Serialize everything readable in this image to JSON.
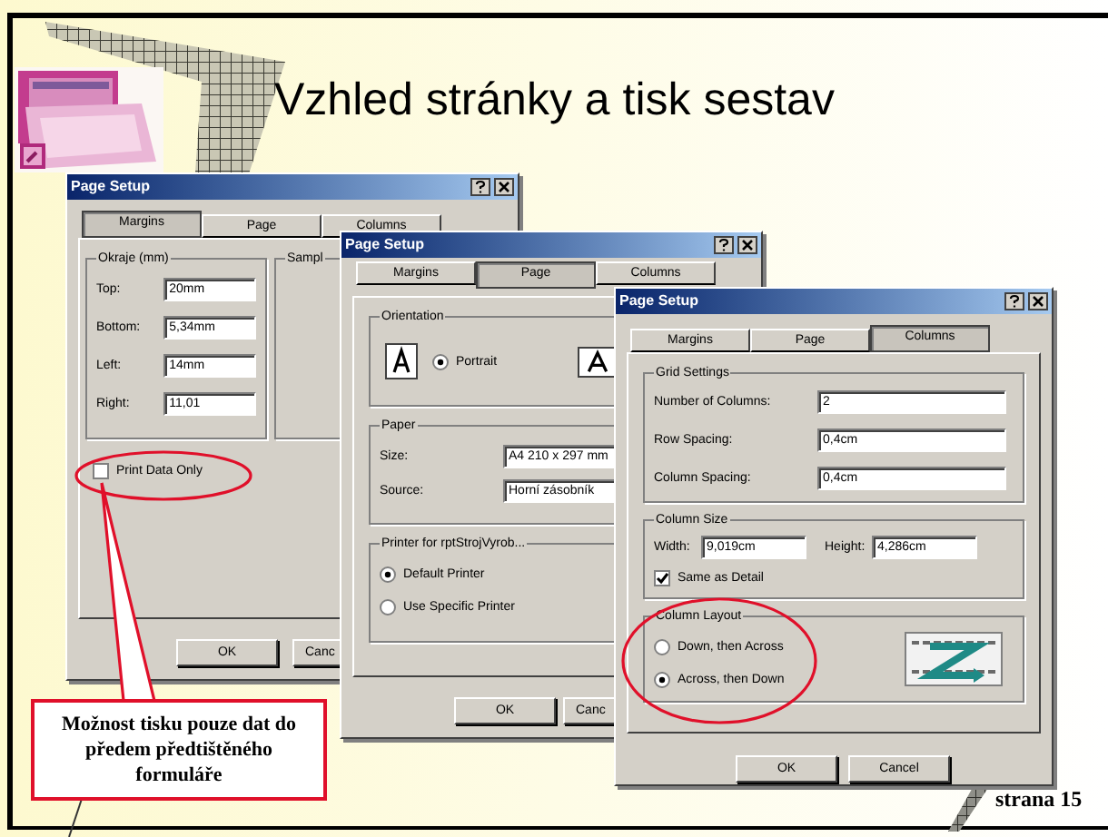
{
  "slide": {
    "title": "Vzhled stránky a tisk sestav",
    "callout": "Možnost tisku pouze dat do předem předtištěného formuláře",
    "page_number": "strana 15"
  },
  "dialogs": [
    {
      "kind": "margins",
      "title": "Page Setup",
      "tabs": [
        {
          "label": "Margins",
          "selected": true
        },
        {
          "label": "Page",
          "selected": false
        },
        {
          "label": "Columns",
          "selected": false
        }
      ],
      "margins_group": {
        "label": "Okraje (mm)",
        "fields": [
          {
            "label": "Top:",
            "value": "20mm"
          },
          {
            "label": "Bottom:",
            "value": "5,34mm"
          },
          {
            "label": "Left:",
            "value": "14mm"
          },
          {
            "label": "Right:",
            "value": "11,01"
          }
        ]
      },
      "sample_group": {
        "label": "Sampl"
      },
      "print_data_only": {
        "label": "Print Data Only",
        "checked": false
      },
      "buttons": [
        "OK",
        "Canc"
      ]
    },
    {
      "kind": "page",
      "title": "Page Setup",
      "tabs": [
        {
          "label": "Margins",
          "selected": false
        },
        {
          "label": "Page",
          "selected": true
        },
        {
          "label": "Columns",
          "selected": false
        }
      ],
      "orientation": {
        "label": "Orientation",
        "options": [
          {
            "label": "Portrait",
            "selected": true
          }
        ]
      },
      "paper": {
        "label": "Paper",
        "fields": [
          {
            "label": "Size:",
            "value": "A4 210 x 297 mm"
          },
          {
            "label": "Source:",
            "value": "Horní zásobník"
          }
        ]
      },
      "printer": {
        "label": "Printer for rptStrojVyrob...",
        "options": [
          {
            "label": "Default Printer",
            "selected": true
          },
          {
            "label": "Use Specific Printer",
            "selected": false
          }
        ]
      },
      "buttons": [
        "OK",
        "Canc"
      ]
    },
    {
      "kind": "columns",
      "title": "Page Setup",
      "tabs": [
        {
          "label": "Margins",
          "selected": false
        },
        {
          "label": "Page",
          "selected": false
        },
        {
          "label": "Columns",
          "selected": true
        }
      ],
      "grid": {
        "label": "Grid Settings",
        "fields": [
          {
            "label": "Number of Columns:",
            "value": "2"
          },
          {
            "label": "Row Spacing:",
            "value": "0,4cm"
          },
          {
            "label": "Column Spacing:",
            "value": "0,4cm"
          }
        ]
      },
      "column_size": {
        "label": "Column Size",
        "fields": [
          {
            "label": "Width:",
            "value": "9,019cm"
          },
          {
            "label": "Height:",
            "value": "4,286cm"
          }
        ],
        "same_as_detail": {
          "label": "Same as Detail",
          "checked": true
        }
      },
      "column_layout": {
        "label": "Column Layout",
        "options": [
          {
            "label": "Down, then Across",
            "selected": false
          },
          {
            "label": "Across, then Down",
            "selected": true
          }
        ]
      },
      "buttons": [
        "OK",
        "Cancel"
      ]
    }
  ]
}
